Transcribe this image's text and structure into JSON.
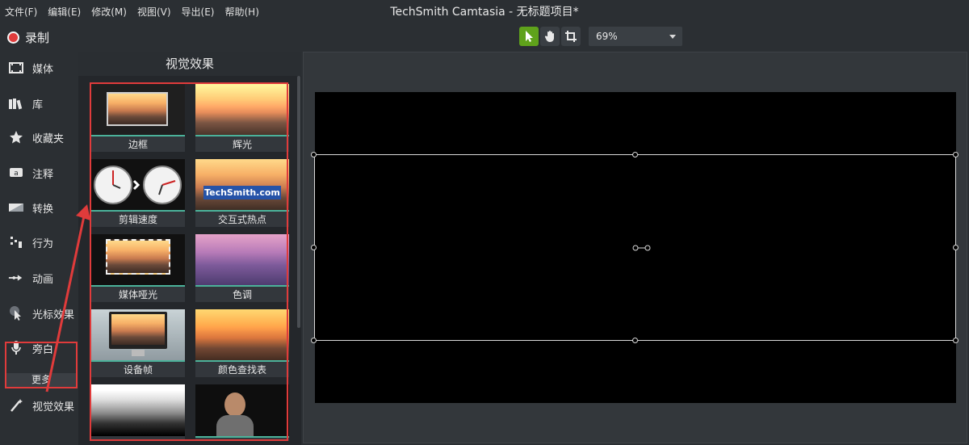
{
  "menu": {
    "items": [
      "文件(F)",
      "编辑(E)",
      "修改(M)",
      "视图(V)",
      "导出(E)",
      "帮助(H)"
    ]
  },
  "app": {
    "title": "TechSmith Camtasia - 无标题项目*"
  },
  "toolbar": {
    "record_label": "录制",
    "zoom_value": "69%",
    "tools": [
      {
        "icon": "pointer-arrow-icon",
        "active": true
      },
      {
        "icon": "hand-pan-icon",
        "active": false
      },
      {
        "icon": "crop-icon",
        "active": false
      }
    ]
  },
  "sidebar": {
    "items": [
      {
        "label": "媒体",
        "icon": "film-strip-icon"
      },
      {
        "label": "库",
        "icon": "library-books-icon"
      },
      {
        "label": "收藏夹",
        "icon": "star-icon"
      },
      {
        "label": "注释",
        "icon": "annotation-icon"
      },
      {
        "label": "转换",
        "icon": "transition-icon"
      },
      {
        "label": "行为",
        "icon": "behavior-icon"
      },
      {
        "label": "动画",
        "icon": "animation-arrow-icon"
      },
      {
        "label": "光标效果",
        "icon": "cursor-effect-icon"
      },
      {
        "label": "旁白",
        "icon": "microphone-icon"
      },
      {
        "label": "视觉效果",
        "icon": "magic-wand-icon",
        "active": true
      }
    ],
    "more_label": "更多"
  },
  "panel": {
    "title": "视觉效果",
    "effects": [
      {
        "label": "边框"
      },
      {
        "label": "辉光"
      },
      {
        "label": "剪辑速度"
      },
      {
        "label": "交互式热点",
        "overlay_text": "TechSmith.com"
      },
      {
        "label": "媒体哑光"
      },
      {
        "label": "色调"
      },
      {
        "label": "设备帧"
      },
      {
        "label": "颜色查找表"
      },
      {
        "label": ""
      },
      {
        "label": ""
      }
    ]
  },
  "colors": {
    "accent_green": "#5fa21b",
    "highlight_red": "#e03b3b",
    "record_red": "#e03c3c",
    "tile_bar": "#4bb29a"
  }
}
